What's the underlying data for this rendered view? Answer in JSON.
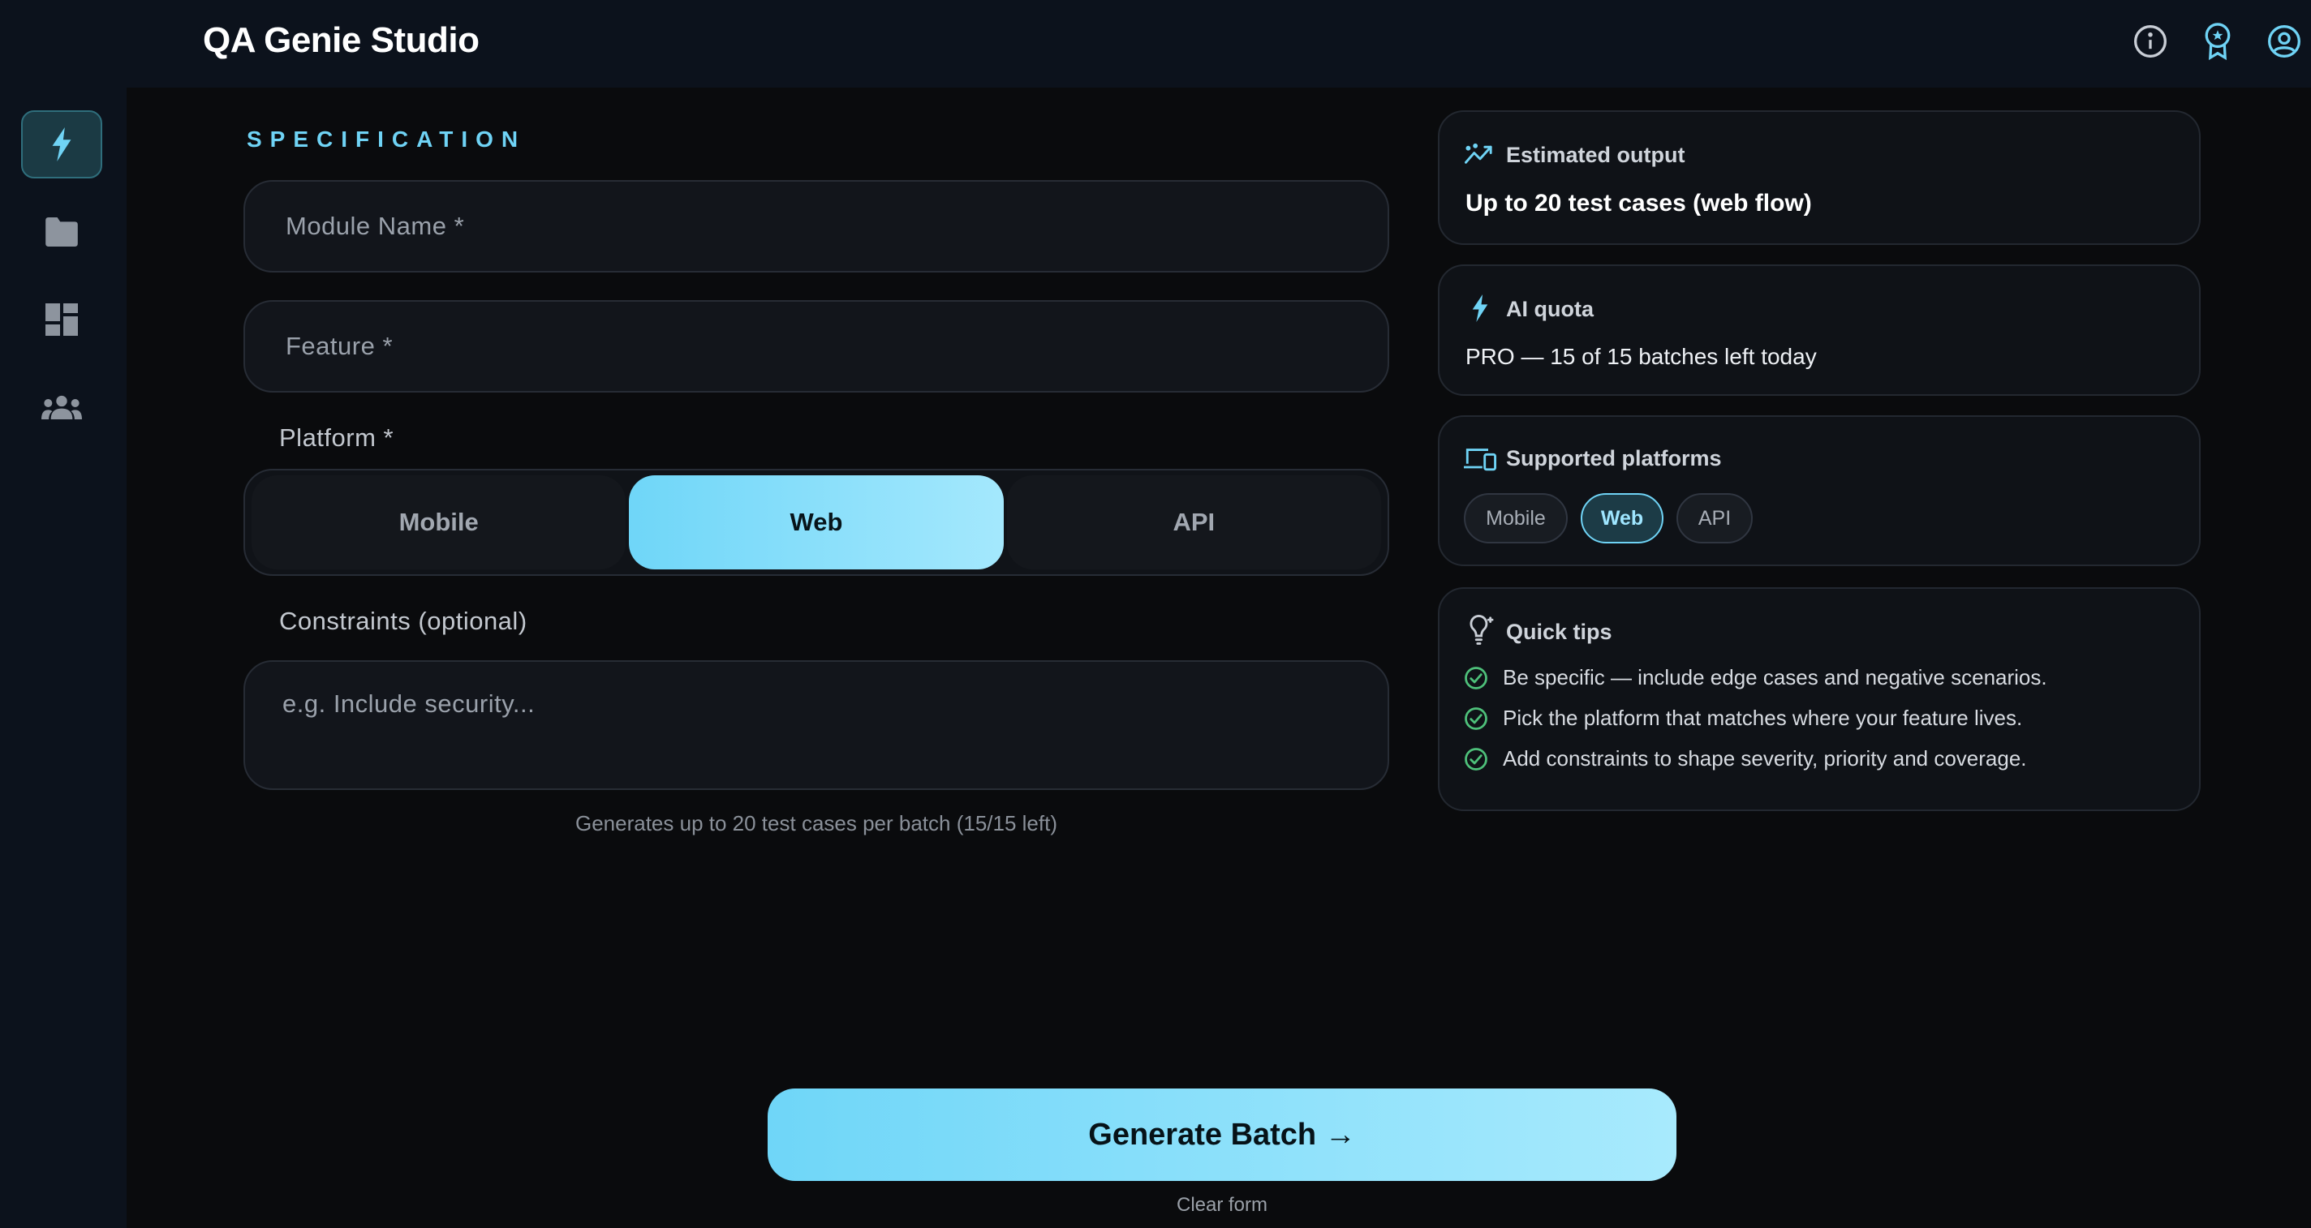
{
  "header": {
    "title": "QA Genie Studio",
    "icons": [
      "info-icon",
      "award-badge-icon",
      "account-icon"
    ]
  },
  "sidebar": {
    "items": [
      {
        "name": "generate",
        "icon": "bolt-icon",
        "active": true
      },
      {
        "name": "projects",
        "icon": "folder-icon",
        "active": false
      },
      {
        "name": "dashboard",
        "icon": "dashboard-icon",
        "active": false
      },
      {
        "name": "team",
        "icon": "group-icon",
        "active": false
      }
    ]
  },
  "form": {
    "section_label": "SPECIFICATION",
    "module_name": {
      "placeholder": "Module Name *",
      "value": ""
    },
    "feature": {
      "placeholder": "Feature *",
      "value": ""
    },
    "platform_label": "Platform *",
    "platforms": [
      {
        "label": "Mobile",
        "active": false
      },
      {
        "label": "Web",
        "active": true
      },
      {
        "label": "API",
        "active": false
      }
    ],
    "constraints_label": "Constraints (optional)",
    "constraints": {
      "placeholder": "e.g. Include security...",
      "value": ""
    },
    "helper": "Generates up to 20 test cases per batch (15/15 left)"
  },
  "cards": {
    "estimated": {
      "title": "Estimated output",
      "body": "Up to 20 test cases (web flow)"
    },
    "quota": {
      "title": "AI quota",
      "body": "PRO — 15 of 15 batches left today"
    },
    "platforms": {
      "title": "Supported platforms",
      "chips": [
        {
          "label": "Mobile",
          "active": false
        },
        {
          "label": "Web",
          "active": true
        },
        {
          "label": "API",
          "active": false
        }
      ]
    },
    "tips": {
      "title": "Quick tips",
      "items": [
        "Be specific — include edge cases and negative scenarios.",
        "Pick the platform that matches where your feature lives.",
        "Add constraints to shape severity, priority and coverage."
      ]
    }
  },
  "actions": {
    "generate": "Generate Batch →",
    "clear": "Clear form"
  },
  "colors": {
    "accent": "#6fd3f5",
    "success": "#4ec07a",
    "background": "#0a0b0d",
    "panel": "#0c121c"
  }
}
